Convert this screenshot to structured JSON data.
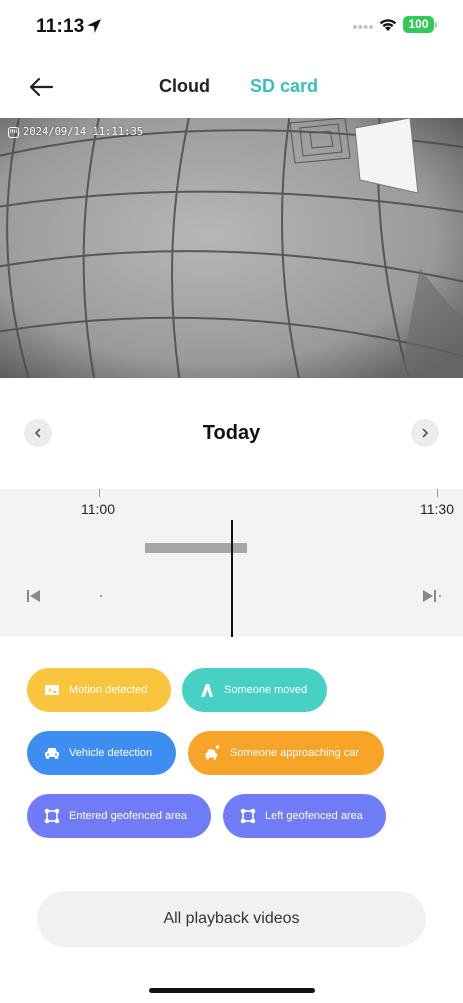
{
  "status_bar": {
    "time": "11:13",
    "battery": "100",
    "icons": [
      "location-arrow-icon",
      "cellular-dots-icon",
      "wifi-icon",
      "battery-icon"
    ]
  },
  "header": {
    "back_icon": "back-arrow-icon",
    "tabs": [
      {
        "label": "Cloud",
        "active": false
      },
      {
        "label": "SD card",
        "active": true
      }
    ],
    "accent_color": "#35c1bb"
  },
  "camera": {
    "timestamp": "2024/09/14  11:11:35",
    "logo_icon": "mi-logo-icon"
  },
  "date_nav": {
    "label": "Today",
    "prev_icon": "chevron-left-icon",
    "next_icon": "chevron-right-icon"
  },
  "timeline": {
    "ticks": [
      "11:00",
      "11:30"
    ],
    "skip_prev_icon": "skip-previous-icon",
    "skip_next_icon": "skip-next-icon"
  },
  "filters": [
    {
      "label": "Motion detected",
      "icon": "motion-icon",
      "color": "#f9c53d"
    },
    {
      "label": "Someone moved",
      "icon": "person-moving-icon",
      "color": "#47d1c5"
    },
    {
      "label": "Vehicle detection",
      "icon": "car-icon",
      "color": "#3e8ef1"
    },
    {
      "label": "Someone approaching car",
      "icon": "person-car-icon",
      "color": "#f8a428"
    },
    {
      "label": "Entered geofenced area",
      "icon": "geofence-icon",
      "color": "#6f7cf6"
    },
    {
      "label": "Left geofenced area",
      "icon": "geofence-icon",
      "color": "#6f7cf6"
    }
  ],
  "footer": {
    "all_playback_label": "All playback videos"
  }
}
